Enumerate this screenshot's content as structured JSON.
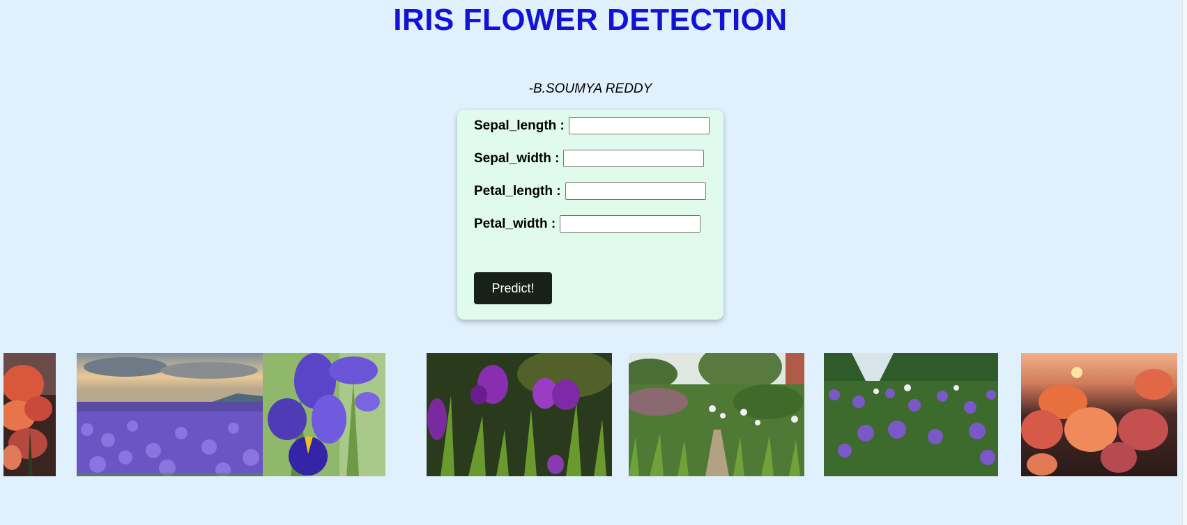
{
  "header": {
    "title": "IRIS FLOWER DETECTION",
    "author": "-B.SOUMYA REDDY"
  },
  "form": {
    "fields": [
      {
        "label": "Sepal_length :",
        "value": "",
        "placeholder": ""
      },
      {
        "label": "Sepal_width :",
        "value": "",
        "placeholder": ""
      },
      {
        "label": "Petal_length :",
        "value": "",
        "placeholder": ""
      },
      {
        "label": "Petal_width :",
        "value": "",
        "placeholder": ""
      }
    ],
    "submit_label": "Predict!"
  },
  "gallery": {
    "images": [
      {
        "subject": "orange iris at sunset (partial)"
      },
      {
        "subject": "lavender iris field under cloudy sky"
      },
      {
        "subject": "blue-violet iris close-up"
      },
      {
        "subject": "purple irises in sunlight"
      },
      {
        "subject": "garden path with irises"
      },
      {
        "subject": "purple iris meadow"
      },
      {
        "subject": "orange irises at sunset"
      }
    ]
  },
  "colors": {
    "background": "#e0f0fd",
    "title": "#1313d8",
    "card": "#e0fbed",
    "button": "#172117"
  }
}
